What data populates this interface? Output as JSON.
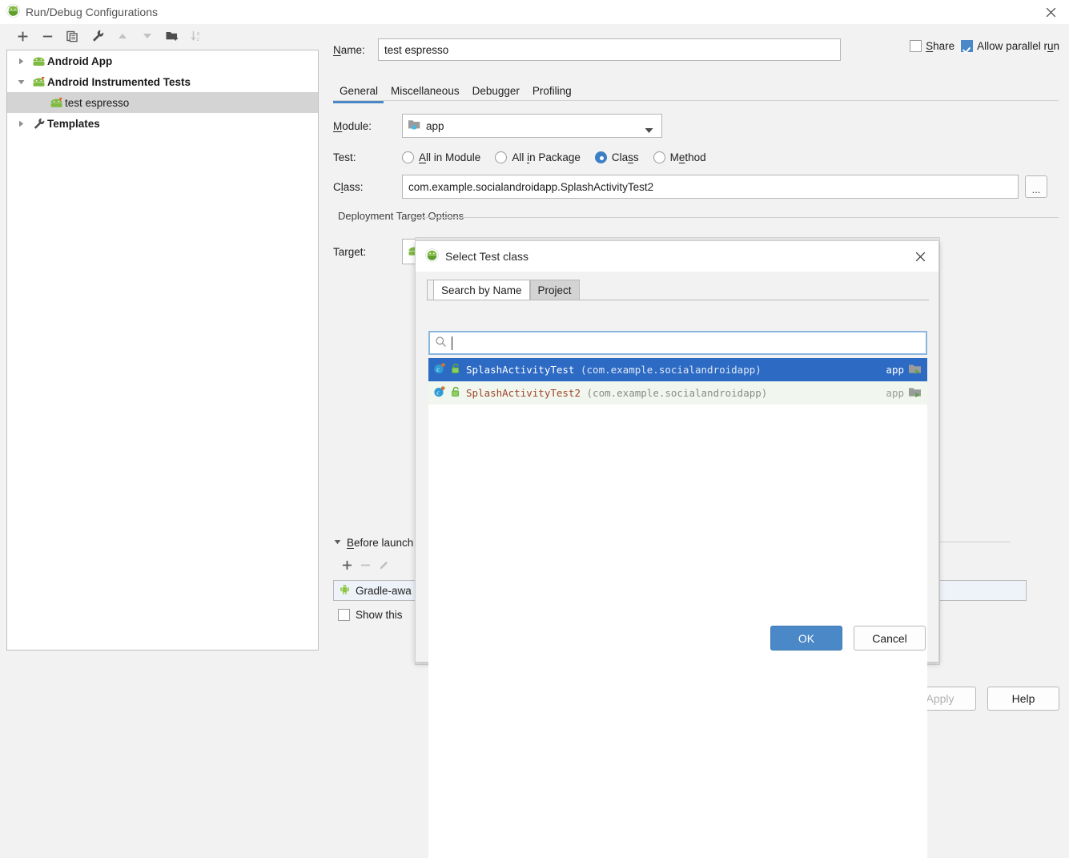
{
  "window": {
    "title": "Run/Debug Configurations",
    "close_icon": "close-icon",
    "app_icon": "android-studio-icon"
  },
  "left_panel": {
    "toolbar": [
      {
        "name": "add-configuration-button",
        "icon": "plus-icon",
        "enabled": true
      },
      {
        "name": "remove-configuration-button",
        "icon": "minus-icon",
        "enabled": true
      },
      {
        "name": "copy-configuration-button",
        "icon": "copy-icon",
        "enabled": true
      },
      {
        "name": "edit-templates-button",
        "icon": "wrench-icon",
        "enabled": true
      },
      {
        "name": "move-up-button",
        "icon": "arrow-up-icon",
        "enabled": false
      },
      {
        "name": "move-down-button",
        "icon": "arrow-down-icon",
        "enabled": false
      },
      {
        "name": "move-into-folder-button",
        "icon": "folder-add-icon",
        "enabled": true
      },
      {
        "name": "sort-configurations-button",
        "icon": "sort-az-icon",
        "enabled": false
      }
    ],
    "tree": [
      {
        "label": "Android App",
        "icon": "android-icon",
        "expanded": false,
        "level": 0,
        "selected": false,
        "bold": true
      },
      {
        "label": "Android Instrumented Tests",
        "icon": "android-test-icon",
        "expanded": true,
        "level": 0,
        "selected": false,
        "bold": true
      },
      {
        "label": "test espresso",
        "icon": "android-test-icon",
        "level": 1,
        "selected": true,
        "bold": false
      },
      {
        "label": "Templates",
        "icon": "wrench-icon",
        "expanded": false,
        "level": 0,
        "selected": false,
        "bold": true
      }
    ]
  },
  "config": {
    "name_label": "Name:",
    "name_value": "test espresso",
    "share": {
      "label": "Share",
      "checked": false
    },
    "allow_parallel_run": {
      "label": "Allow parallel run",
      "checked": true
    },
    "tabs": [
      {
        "label": "General",
        "active": true
      },
      {
        "label": "Miscellaneous",
        "active": false
      },
      {
        "label": "Debugger",
        "active": false
      },
      {
        "label": "Profiling",
        "active": false
      }
    ],
    "module_label": "Module:",
    "module_value": "app",
    "test_label": "Test:",
    "test_options": [
      {
        "label": "All in Module",
        "selected": false
      },
      {
        "label": "All in Package",
        "selected": false
      },
      {
        "label": "Class",
        "selected": true
      },
      {
        "label": "Method",
        "selected": false
      }
    ],
    "class_label": "Class:",
    "class_value": "com.example.socialandroidapp.SplashActivityTest2",
    "class_browse_label": "...",
    "deployment_group_label": "Deployment Target Options",
    "target_label": "Target:",
    "target_value": "",
    "before_launch": {
      "label": "Before launch",
      "tools": [
        {
          "name": "add-task-button",
          "icon": "plus-icon",
          "enabled": true
        },
        {
          "name": "remove-task-button",
          "icon": "minus-icon",
          "enabled": false
        },
        {
          "name": "edit-task-button",
          "icon": "pencil-icon",
          "enabled": false
        }
      ],
      "item_label": "Gradle-awa",
      "item_icon": "android-icon",
      "show_checkbox": {
        "label": "Show this",
        "checked": false
      }
    },
    "buttons": [
      {
        "label": "OK",
        "style": "primary",
        "name": "ok-button",
        "enabled": true
      },
      {
        "label": "Cancel",
        "style": "default",
        "name": "cancel-button",
        "enabled": true
      },
      {
        "label": "Apply",
        "style": "disabled",
        "name": "apply-button",
        "enabled": false
      },
      {
        "label": "Help",
        "style": "default",
        "name": "help-button",
        "enabled": true
      }
    ]
  },
  "modal": {
    "title": "Select Test class",
    "app_icon": "android-studio-icon",
    "close_icon": "close-icon",
    "tabs": [
      {
        "label": "Search by Name",
        "active": true
      },
      {
        "label": "Project",
        "active": false
      }
    ],
    "search": {
      "value": "",
      "placeholder": "",
      "icon": "search-icon"
    },
    "results": [
      {
        "class_name": "SplashActivityTest",
        "package": "(com.example.socialandroidapp)",
        "module": "app",
        "selected": true,
        "class_icon": "java-class-test-icon",
        "visibility_icon": "unlock-green-icon",
        "module_icon": "module-folder-icon"
      },
      {
        "class_name": "SplashActivityTest2",
        "package": "(com.example.socialandroidapp)",
        "module": "app",
        "selected": false,
        "class_icon": "java-class-test-icon",
        "visibility_icon": "unlock-green-icon",
        "module_icon": "module-folder-icon"
      }
    ],
    "buttons": [
      {
        "label": "OK",
        "style": "primary",
        "name": "modal-ok-button"
      },
      {
        "label": "Cancel",
        "style": "default",
        "name": "modal-cancel-button"
      }
    ]
  },
  "colors": {
    "accent": "#4a88c7",
    "selection": "#2d6ac4",
    "tree_selection": "#d4d4d4",
    "window_bg": "#f2f2f2",
    "class_text": "#a0452a"
  }
}
